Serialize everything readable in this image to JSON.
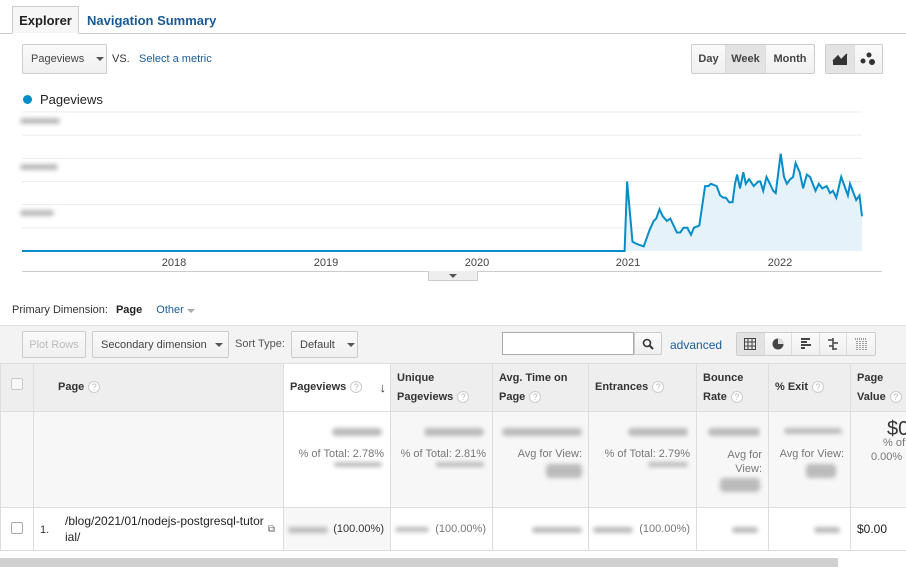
{
  "tabs": [
    {
      "label": "Explorer",
      "active": true
    },
    {
      "label": "Navigation Summary",
      "active": false
    }
  ],
  "metric_select": {
    "value": "Pageviews",
    "vs_label": "VS.",
    "compare_link": "Select a metric"
  },
  "granularity": {
    "options": [
      "Day",
      "Week",
      "Month"
    ],
    "selected": "Week"
  },
  "chart_type": {
    "options": [
      "line-chart-icon",
      "motion-chart-icon"
    ],
    "selected": "line-chart-icon"
  },
  "legend": {
    "label": "Pageviews",
    "color": "#058dc7"
  },
  "chart_data": {
    "type": "area",
    "series": [
      {
        "name": "Pageviews",
        "color": "#058dc7",
        "fill": "#e6f2fa",
        "points": [
          [
            "2017-01-01",
            0
          ],
          [
            "2020-12-23",
            0
          ],
          [
            "2020-12-29",
            3.0
          ],
          [
            "2021-01-11",
            0.4
          ],
          [
            "2021-01-22",
            0.3
          ],
          [
            "2021-02-07",
            0.2
          ],
          [
            "2021-02-21",
            0.9
          ],
          [
            "2021-03-03",
            1.3
          ],
          [
            "2021-03-09",
            1.4
          ],
          [
            "2021-03-17",
            1.8
          ],
          [
            "2021-03-25",
            1.5
          ],
          [
            "2021-04-04",
            1.3
          ],
          [
            "2021-04-12",
            1.4
          ],
          [
            "2021-04-20",
            1.1
          ],
          [
            "2021-04-28",
            0.8
          ],
          [
            "2021-05-06",
            0.8
          ],
          [
            "2021-05-14",
            1.0
          ],
          [
            "2021-05-23",
            1.0
          ],
          [
            "2021-06-01",
            0.7
          ],
          [
            "2021-06-08",
            1.0
          ],
          [
            "2021-06-21",
            1.1
          ],
          [
            "2021-07-05",
            2.8
          ],
          [
            "2021-07-13",
            2.8
          ],
          [
            "2021-07-19",
            2.9
          ],
          [
            "2021-08-02",
            2.8
          ],
          [
            "2021-08-10",
            2.4
          ],
          [
            "2021-08-18",
            2.3
          ],
          [
            "2021-08-24",
            2.3
          ],
          [
            "2021-09-01",
            2.1
          ],
          [
            "2021-09-09",
            2.1
          ],
          [
            "2021-09-15",
            2.9
          ],
          [
            "2021-09-20",
            3.3
          ],
          [
            "2021-09-27",
            2.7
          ],
          [
            "2021-10-05",
            3.4
          ],
          [
            "2021-10-11",
            2.9
          ],
          [
            "2021-10-19",
            3.1
          ],
          [
            "2021-10-30",
            2.8
          ],
          [
            "2021-11-10",
            3.0
          ],
          [
            "2021-11-15",
            3.0
          ],
          [
            "2021-11-22",
            2.6
          ],
          [
            "2021-11-30",
            3.2
          ],
          [
            "2021-12-08",
            2.9
          ],
          [
            "2021-12-16",
            2.6
          ],
          [
            "2021-12-22",
            2.5
          ],
          [
            "2022-01-03",
            4.2
          ],
          [
            "2022-01-11",
            3.2
          ],
          [
            "2022-01-18",
            2.9
          ],
          [
            "2022-01-26",
            3.1
          ],
          [
            "2022-02-02",
            3.2
          ],
          [
            "2022-02-08",
            3.8
          ],
          [
            "2022-02-18",
            3.4
          ],
          [
            "2022-02-26",
            2.7
          ],
          [
            "2022-03-07",
            3.3
          ],
          [
            "2022-03-15",
            3.2
          ],
          [
            "2022-03-28",
            2.6
          ],
          [
            "2022-04-05",
            2.9
          ],
          [
            "2022-04-13",
            2.7
          ],
          [
            "2022-04-24",
            2.8
          ],
          [
            "2022-05-02",
            2.5
          ],
          [
            "2022-05-09",
            2.6
          ],
          [
            "2022-05-17",
            2.3
          ],
          [
            "2022-05-29",
            3.2
          ],
          [
            "2022-06-14",
            2.4
          ],
          [
            "2022-06-19",
            2.9
          ],
          [
            "2022-07-04",
            2.2
          ],
          [
            "2022-07-12",
            2.4
          ],
          [
            "2022-07-18",
            1.5
          ]
        ]
      }
    ],
    "xlim": [
      "2017-01-01",
      "2022-07-18"
    ],
    "ylim": [
      0,
      6
    ],
    "x_ticks": [
      "2018",
      "2019",
      "2020",
      "2021",
      "2022"
    ],
    "y_tick_labels_redacted": true,
    "grid": true,
    "legend_position": "top-left"
  },
  "dimension": {
    "label": "Primary Dimension:",
    "selected": "Page",
    "other": "Other"
  },
  "toolbar": {
    "plot_rows": "Plot Rows",
    "secondary": "Secondary dimension",
    "sort_label": "Sort Type:",
    "sort_value": "Default",
    "search_value": "",
    "advanced": "advanced",
    "views": [
      "table-view-icon",
      "pie-view-icon",
      "bar-view-icon",
      "comparison-view-icon",
      "pivot-view-icon"
    ]
  },
  "table": {
    "headers": [
      "Page",
      "Pageviews",
      "Unique Pageviews",
      "Avg. Time on Page",
      "Entrances",
      "Bounce Rate",
      "% Exit",
      "Page Value"
    ],
    "totals": {
      "pageviews": "% of Total: 2.78%",
      "unique": "% of Total: 2.81%",
      "avg_time": "Avg for View:",
      "entrances": "% of Total: 2.79%",
      "bounce": "Avg for View:",
      "exit": "Avg for View:",
      "value": "$0",
      "value_sub": "% of",
      "value_sub2": "0.00%"
    },
    "rows": [
      {
        "index": "1.",
        "page": "/blog/2021/01/nodejs-postgresql-tutorial/",
        "pageviews_pct": "(100.00%)",
        "unique_pct": "(100.00%)",
        "entrances_pct": "(100.00%)",
        "value": "$0.00"
      }
    ]
  }
}
